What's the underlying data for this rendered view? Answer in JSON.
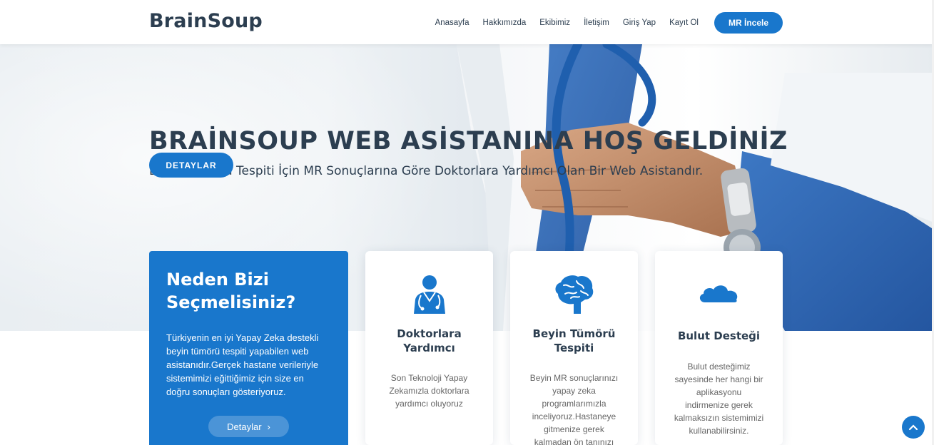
{
  "header": {
    "logo": "BrainSoup",
    "nav": [
      "Anasayfa",
      "Hakkımızda",
      "Ekibimiz",
      "İletişim",
      "Giriş Yap",
      "Kayıt Ol"
    ],
    "cta": "MR İncele"
  },
  "hero": {
    "title": "BRAİNSOUP WEB ASİSTANINA HOŞ GELDİNİZ",
    "subtitle": "Beyin Tümörü Tespiti İçin MR Sonuçlarına Göre Doktorlara Yardımcı Olan Bir Web Asistandır.",
    "button": "DETAYLAR"
  },
  "why": {
    "title": "Neden Bizi Seçmelisiniz?",
    "text": "Türkiyenin en iyi Yapay Zeka destekli beyin tümörü tespiti yapabilen web asistanıdır.Gerçek hastane verileriyle sistemimizi eğittiğimiz için size en doğru sonuçları gösteriyoruz.",
    "button": "Detaylar",
    "button_icon": "chevron-right-icon"
  },
  "cards": [
    {
      "icon": "doctor-icon",
      "title": "Doktorlara Yardımcı",
      "text": "Son Teknoloji Yapay Zekamızla doktorlara yardımcı oluyoruz"
    },
    {
      "icon": "brain-icon",
      "title": "Beyin Tümörü Tespiti",
      "text": "Beyin MR sonuçlarınızı yapay zeka programlarımızla inceliyoruz.Hastaneye gitmenize gerek kalmadan ön tanınızı"
    },
    {
      "icon": "cloud-icon",
      "title": "Bulut Desteği",
      "text": "Bulut desteğimiz sayesinde her hangi bir aplikasyonu indirmenize gerek kalmaksızın sistemimizi kullanabilirsiniz."
    }
  ],
  "colors": {
    "primary": "#1977cc",
    "heading": "#2c3e50",
    "body_text": "#666666"
  }
}
